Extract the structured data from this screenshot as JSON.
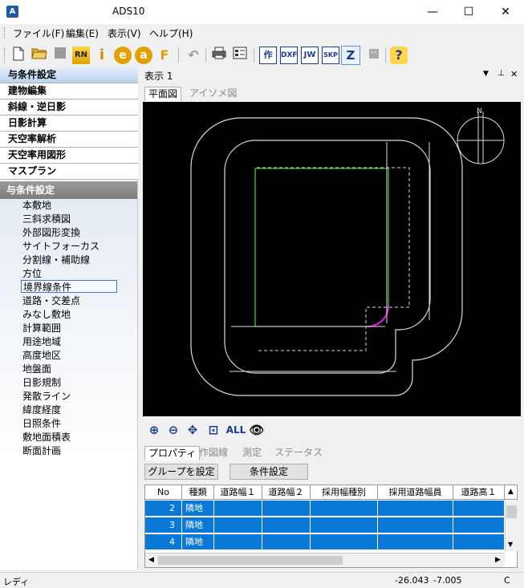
{
  "window": {
    "title": "ADS10",
    "app_icon": "A"
  },
  "window_buttons": {
    "minimize": "—",
    "maximize": "☐",
    "close": "✕"
  },
  "menu": [
    "ファイル(F)",
    "編集(E)",
    "表示(V)",
    "ヘルプ(H)"
  ],
  "toolbar": {
    "rn": "RN",
    "i": "i",
    "e": "e",
    "a": "a",
    "f": "F",
    "saku": "作",
    "dxf": "DXF",
    "jw": "JW",
    "skp": "SKP",
    "z": "Z",
    "help": "?"
  },
  "categories": [
    "与条件設定",
    "建物編集",
    "斜線・逆日影",
    "日影計算",
    "天空率解析",
    "天空率用図形",
    "マスプラン"
  ],
  "section_header": "与条件設定",
  "sub_items": [
    "本敷地",
    "三斜求積図",
    "外部図形変換",
    "サイトフォーカス",
    "分割線・補助線",
    "方位",
    "境界線条件",
    "道路・交差点",
    "みなし敷地",
    "計算範囲",
    "用途地域",
    "高度地区",
    "地盤面",
    "日影規制",
    "発散ライン",
    "緯度経度",
    "日照条件",
    "敷地面積表",
    "断面計画"
  ],
  "view": {
    "title": "表示 1",
    "tabs": [
      "平面図",
      "アイソメ図"
    ],
    "controls": {
      "dropdown": "▼",
      "pin": "⊥",
      "close": "✕"
    },
    "compass_label": "N"
  },
  "zoombar": {
    "all": "ALL"
  },
  "props": {
    "tabs": [
      "プロパティ",
      "作図線",
      "測定",
      "ステータス"
    ],
    "buttons": [
      "グループを設定",
      "条件設定"
    ],
    "columns": [
      "No",
      "種類",
      "道路幅１",
      "道路幅２",
      "採用幅種別",
      "採用道路幅員",
      "道路高１"
    ],
    "rows": [
      {
        "no": "2",
        "kind": "隣地"
      },
      {
        "no": "3",
        "kind": "隣地"
      },
      {
        "no": "4",
        "kind": "隣地"
      }
    ]
  },
  "status": {
    "left": "レディ",
    "x": "-26.043",
    "y": "-7.005",
    "right": "C"
  },
  "colors": {
    "accent_blue": "#0a78d7",
    "canvas_bg": "#000000",
    "site_green": "#3cc83c",
    "arc_magenta": "#e020e0"
  }
}
